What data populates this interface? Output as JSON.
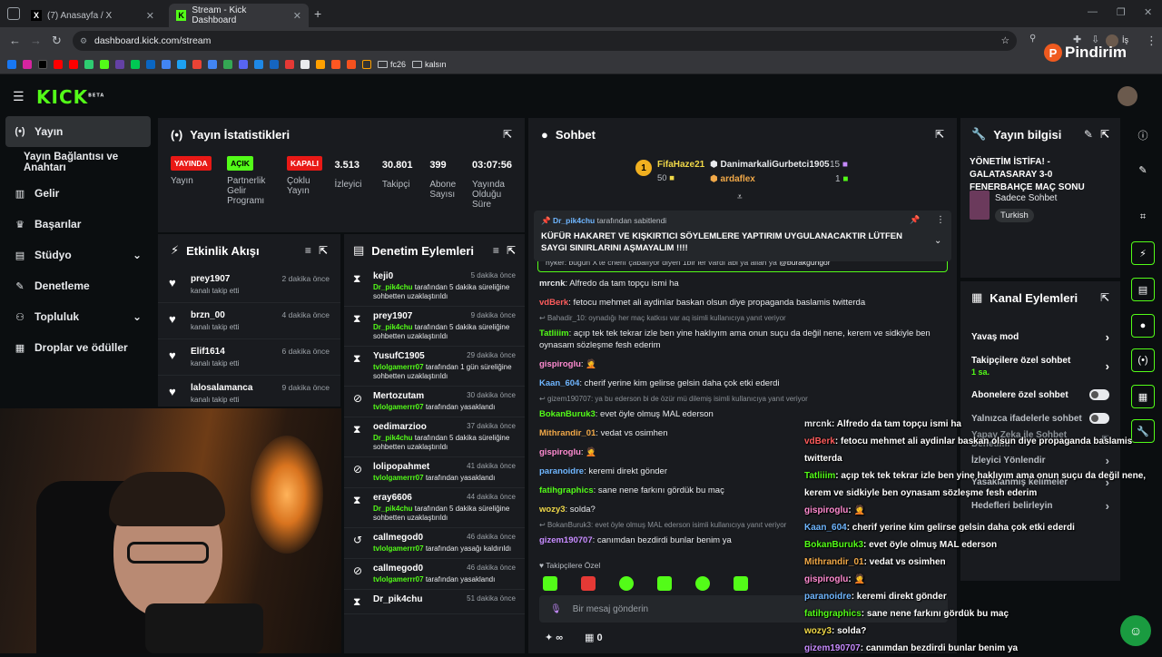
{
  "browser": {
    "tabs": [
      {
        "title": "(7) Anasayfa / X",
        "favicon": "x-icon"
      },
      {
        "title": "Stream - Kick Dashboard",
        "favicon": "kick-icon"
      }
    ],
    "url": "dashboard.kick.com/stream",
    "bookmarks": {
      "folder1": "fc26",
      "folder2": "kalsın"
    },
    "profile_label": "İş"
  },
  "watermark": "Pindirim",
  "kick": {
    "logo": "KICK",
    "logo_sup": "BETA"
  },
  "sidebar": {
    "items": [
      {
        "label": "Yayın",
        "icon": "broadcast-icon"
      },
      {
        "label": "Yayın Bağlantısı ve Anahtarı",
        "icon": ""
      },
      {
        "label": "Gelir",
        "icon": "chart-icon"
      },
      {
        "label": "Başarılar",
        "icon": "trophy-icon"
      },
      {
        "label": "Stüdyo",
        "icon": "studio-icon"
      },
      {
        "label": "Denetleme",
        "icon": "wrench-icon"
      },
      {
        "label": "Topluluk",
        "icon": "people-icon"
      },
      {
        "label": "Droplar ve ödüller",
        "icon": "gift-icon"
      }
    ]
  },
  "stats_panel": {
    "title": "Yayın İstatistikleri",
    "items": [
      {
        "badge": "YAYINDA",
        "label": "Yayın"
      },
      {
        "badge": "AÇIK",
        "label": "Partnerlik Gelir Programı"
      },
      {
        "badge": "KAPALI",
        "label": "Çoklu Yayın"
      },
      {
        "value": "3.513",
        "label": "İzleyici"
      },
      {
        "value": "30.801",
        "label": "Takipçi"
      },
      {
        "value": "399",
        "label": "Abone Sayısı"
      },
      {
        "value": "03:07:56",
        "label": "Yayında Olduğu Süre"
      }
    ]
  },
  "activity": {
    "title": "Etkinlik Akışı",
    "rows": [
      {
        "name": "prey1907",
        "sub": "kanalı takip etti",
        "time": "2 dakika önce"
      },
      {
        "name": "brzn_00",
        "sub": "kanalı takip etti",
        "time": "4 dakika önce"
      },
      {
        "name": "Elif1614",
        "sub": "kanalı takip etti",
        "time": "6 dakika önce"
      },
      {
        "name": "lalosalamanca",
        "sub": "kanalı takip etti",
        "time": "9 dakika önce"
      }
    ]
  },
  "moderation": {
    "title": "Denetim Eylemleri",
    "rows": [
      {
        "icon": "hourglass-icon",
        "name": "keji0",
        "by": "Dr_pik4chu",
        "rest": " tarafından 5 dakika süreliğine sohbetten uzaklaştırıldı",
        "time": "5 dakika önce"
      },
      {
        "icon": "hourglass-icon",
        "name": "prey1907",
        "by": "Dr_pik4chu",
        "rest": " tarafından 5 dakika süreliğine sohbetten uzaklaştırıldı",
        "time": "9 dakika önce"
      },
      {
        "icon": "hourglass-icon",
        "name": "YusufC1905",
        "by": "tvlolgamerrr07",
        "rest": " tarafından 1 gün süreliğine sohbetten uzaklaştırıldı",
        "time": "29 dakika önce"
      },
      {
        "icon": "ban-icon",
        "name": "Mertozutam",
        "by": "tvlolgamerrr07",
        "rest": " tarafından yasaklandı",
        "time": "30 dakika önce"
      },
      {
        "icon": "hourglass-icon",
        "name": "oedimarzioo",
        "by": "Dr_pik4chu",
        "rest": " tarafından 5 dakika süreliğine sohbetten uzaklaştırıldı",
        "time": "37 dakika önce"
      },
      {
        "icon": "ban-icon",
        "name": "lolipopahmet",
        "by": "tvlolgamerrr07",
        "rest": " tarafından yasaklandı",
        "time": "41 dakika önce"
      },
      {
        "icon": "hourglass-icon",
        "name": "eray6606",
        "by": "Dr_pik4chu",
        "rest": " tarafından 5 dakika süreliğine sohbetten uzaklaştırıldı",
        "time": "44 dakika önce"
      },
      {
        "icon": "undo-icon",
        "name": "callmegod0",
        "by": "tvlolgamerrr07",
        "rest": " tarafından yasağı kaldırıldı",
        "time": "46 dakika önce"
      },
      {
        "icon": "ban-icon",
        "name": "callmegod0",
        "by": "tvlolgamerrr07",
        "rest": " tarafından yasaklandı",
        "time": "46 dakika önce"
      },
      {
        "icon": "hourglass-icon",
        "name": "Dr_pik4chu",
        "by": "",
        "rest": "",
        "time": "51 dakika önce"
      }
    ]
  },
  "chat": {
    "title": "Sohbet",
    "top1": {
      "rank": "1",
      "name": "FifaHaze21",
      "amount": "50"
    },
    "top2": {
      "name": "DanimarkaliGurbetci1905",
      "amount": "15"
    },
    "top3": {
      "name": "ardaflex",
      "amount": "1"
    },
    "pinned": {
      "by": "Dr_pik4chu",
      "by_suffix": "tarafından sabitlendi",
      "text": "KÜFÜR HAKARET VE KIŞKIRTICI SÖYLEMLERE YAPTIRIM UYGULANACAKTIR LÜTFEN SAYGI SINIRLARINI AŞMAYALIM !!!!"
    },
    "partial_line": "hyker: bugün X'te cherif çabalıyor diyen 1bir ler vardı abi ya allah ya",
    "partial_mention": "@burakgungor",
    "messages": [
      {
        "user": "mrcnk",
        "color": "#e8eaed",
        "text": ": Alfredo da tam topçu ismi ha"
      },
      {
        "user": "vdBerk",
        "color": "#ff5c5c",
        "text": ": fetocu mehmet ali aydinlar baskan olsun diye propaganda baslamis twitterda"
      },
      {
        "reply": "Bahadir_10: oynadığı her maç katkısı var aq isimli kullanıcıya yanıt veriyor"
      },
      {
        "user": "Tatliiim",
        "color": "#53fc18",
        "text": ": açıp tek tek tekrar izle ben yine haklıyım ama onun suçu da değil nene, kerem ve sidkiyle ben oynasam sözleşme fesh ederim"
      },
      {
        "user": "gispiroglu",
        "color": "#ff8bd1",
        "text": ": 🤦"
      },
      {
        "user": "Kaan_604",
        "color": "#6fb6ff",
        "text": ": cherif yerine kim gelirse gelsin daha çok etki ederdi"
      },
      {
        "reply": "gizem190707: ya bu ederson bi de özür mü dilemiş isimli kullanıcıya yanıt veriyor"
      },
      {
        "user": "BokanBuruk3",
        "color": "#53fc18",
        "text": ": evet öyle olmuş MAL ederson"
      },
      {
        "user": "Mithrandir_01",
        "color": "#f0a848",
        "text": ": vedat vs osimhen"
      },
      {
        "user": "gispiroglu",
        "color": "#ff8bd1",
        "text": ": 🤦"
      },
      {
        "user": "paranoidre",
        "color": "#6fb6ff",
        "text": ": keremi direkt gönder"
      },
      {
        "user": "fatihgraphics",
        "color": "#53fc18",
        "text": ": sane nene farkını gördük bu maç"
      },
      {
        "user": "wozy3",
        "color": "#f0d848",
        "text": ": solda?"
      },
      {
        "reply": "BokanBuruk3: evet öyle olmuş MAL ederson isimli kullanıcıya yanıt veriyor"
      },
      {
        "user": "gizem190707",
        "color": "#c78bff",
        "text": ": canımdan bezdirdi bunlar benim ya"
      }
    ],
    "followers_label": "Takipçilere Özel",
    "input_placeholder": "Bir mesaj gönderin",
    "counter_infinity": "∞",
    "counter_zero": "0"
  },
  "stream_info": {
    "title": "Yayın bilgisi",
    "stream_title": "YÖNETİM İSTİFA! - GALATASARAY 3-0 FENERBAHÇE MAÇ SONU",
    "category": "Sadece Sohbet",
    "language": "Turkish"
  },
  "channel_actions": {
    "title": "Kanal Eylemleri",
    "items": [
      {
        "label": "Yavaş mod",
        "type": "chevron"
      },
      {
        "label": "Takipçilere özel sohbet",
        "sub": "1 sa.",
        "type": "chevron"
      },
      {
        "label": "Abonelere özel sohbet",
        "type": "toggle"
      },
      {
        "label": "Yalnızca ifadelerle sohbet",
        "type": "toggle"
      },
      {
        "label": "Yapay Zeka ile Sohbet Denetimi",
        "type": "link"
      },
      {
        "label": "İzleyici Yönlendir",
        "type": "chevron"
      },
      {
        "label": "Yasaklanmış kelimeler",
        "type": "chevron"
      },
      {
        "label": "Hedefleri belirleyin",
        "type": "chevron"
      }
    ]
  },
  "overlay_chat": [
    {
      "user": "mrcnk",
      "color": "#e8eaed",
      "text": ": Alfredo da tam topçu ismi ha"
    },
    {
      "user": "vdBerk",
      "color": "#ff5c5c",
      "text": ": fetocu mehmet ali aydinlar baskan olsun diye propaganda baslamis"
    },
    {
      "cont": "twitterda"
    },
    {
      "user": "Tatliiim",
      "color": "#53fc18",
      "text": ": açıp tek tek tekrar izle ben yine haklıyım ama onun suçu da değil nene,"
    },
    {
      "cont": "kerem ve sidkiyle ben oynasam sözleşme fesh ederim"
    },
    {
      "user": "gispiroglu",
      "color": "#ff8bd1",
      "text": ": 🤦"
    },
    {
      "user": "Kaan_604",
      "color": "#6fb6ff",
      "text": ": cherif yerine kim gelirse gelsin daha çok etki ederdi"
    },
    {
      "user": "BokanBuruk3",
      "color": "#53fc18",
      "text": ": evet öyle olmuş MAL ederson"
    },
    {
      "user": "Mithrandir_01",
      "color": "#f0a848",
      "text": ": vedat vs osimhen"
    },
    {
      "user": "gispiroglu",
      "color": "#ff8bd1",
      "text": ": 🤦"
    },
    {
      "user": "paranoidre",
      "color": "#6fb6ff",
      "text": ": keremi direkt gönder"
    },
    {
      "user": "fatihgraphics",
      "color": "#53fc18",
      "text": ": sane nene farkını gördük bu maç"
    },
    {
      "user": "wozy3",
      "color": "#f0d848",
      "text": ": solda?"
    },
    {
      "user": "gizem190707",
      "color": "#c78bff",
      "text": ": canımdan bezdirdi bunlar benim ya"
    }
  ],
  "colors": {
    "accent": "#53fc18",
    "live": "#e91916",
    "panel": "#191b1f",
    "bg": "#0b0e10"
  }
}
